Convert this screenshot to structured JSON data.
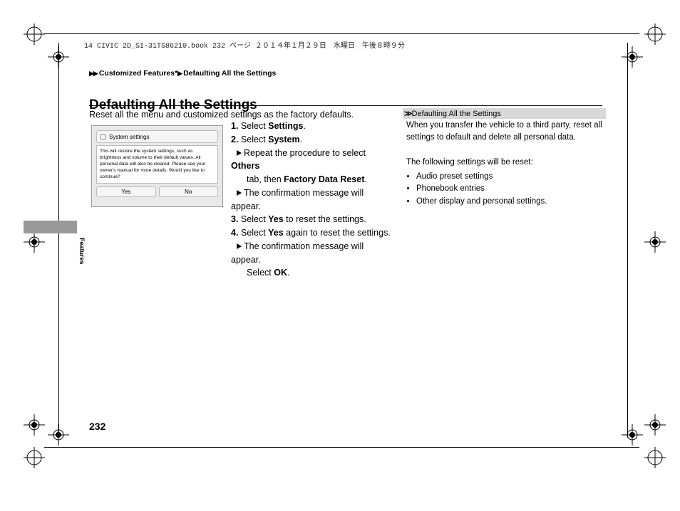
{
  "header": {
    "book_line": "14 CIVIC 2D_SI-31TS86210.book  232 ページ  ２０１４年１月２９日　水曜日　午後８時９分"
  },
  "breadcrumb": {
    "p1": "Customized Features",
    "sep": "*",
    "p2": "Defaulting All the Settings"
  },
  "title": "Defaulting All the Settings",
  "intro": "Reset all the menu and customized settings as the factory defaults.",
  "dialog": {
    "title": "System settings",
    "body": "This will restore the system settings, such as brightness and volume to their default values. All personal data will also be cleared.\nPlease see your owner's manual for more details. Would you like to continue?",
    "yes": "Yes",
    "no": "No"
  },
  "steps": {
    "s1a": "Select ",
    "s1b": "Settings",
    "s1c": ".",
    "s2a": "Select ",
    "s2b": "System",
    "s2c": ".",
    "s2r1a": "Repeat the procedure to select ",
    "s2r1b": "Others",
    "s2r2a": "tab, then ",
    "s2r2b": "Factory Data Reset",
    "s2r2c": ".",
    "s2r3": "The confirmation message will appear.",
    "s3a": "Select ",
    "s3b": "Yes",
    "s3c": " to reset the settings.",
    "s4a": "Select ",
    "s4b": "Yes",
    "s4c": " again to reset the settings.",
    "s4r1": "The confirmation message will appear.",
    "s4r2a": "Select ",
    "s4r2b": "OK",
    "s4r2c": "."
  },
  "sidebar": {
    "title": "Defaulting All the Settings",
    "p1": "When you transfer the vehicle to a third party, reset all settings to default and delete all personal data.",
    "p2": "The following settings will be reset:",
    "b1": "Audio preset settings",
    "b2": "Phonebook entries",
    "b3": "Other display and personal settings."
  },
  "tab_label": "Features",
  "page_number": "232"
}
